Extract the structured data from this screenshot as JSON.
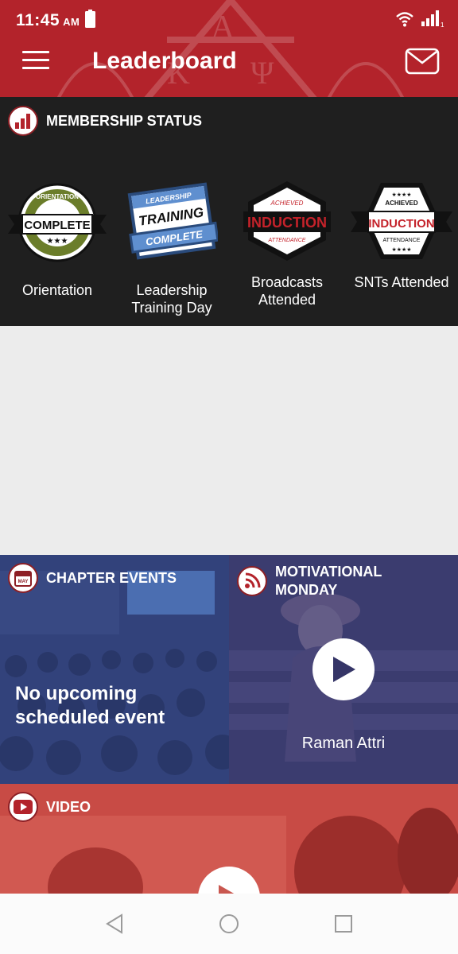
{
  "status_bar": {
    "time": "11:45",
    "ampm": "AM",
    "signal_sub": "1"
  },
  "app_bar": {
    "title": "Leaderboard"
  },
  "membership": {
    "title": "MEMBERSHIP STATUS",
    "badges": [
      {
        "label": "Orientation",
        "art": {
          "top": "ORIENTATION",
          "main": "COMPLETE",
          "stars": "★★★"
        }
      },
      {
        "label": "Leadership Training Day",
        "art": {
          "top": "LEADERSHIP",
          "main": "TRAINING",
          "bottom": "COMPLETE"
        }
      },
      {
        "label": "Broadcasts Attended",
        "art": {
          "top": "ACHIEVED",
          "main": "INDUCTION",
          "bottom": "ATTENDANCE"
        }
      },
      {
        "label": "SNTs Attended",
        "art": {
          "top": "ACHIEVED",
          "main": "INDUCTION",
          "bottom": "ATTENDANCE",
          "stars": "★★★★"
        }
      }
    ]
  },
  "chapter_events": {
    "title": "CHAPTER EVENTS",
    "icon_text": "MAY",
    "message": "No upcoming scheduled event"
  },
  "motivational": {
    "title": "MOTIVATIONAL MONDAY",
    "name": "Raman Attri"
  },
  "video": {
    "title": "VIDEO"
  },
  "colors": {
    "brand_red": "#b3232b",
    "dark": "#1f1f1f",
    "tile_blue": "#3a4e86"
  }
}
